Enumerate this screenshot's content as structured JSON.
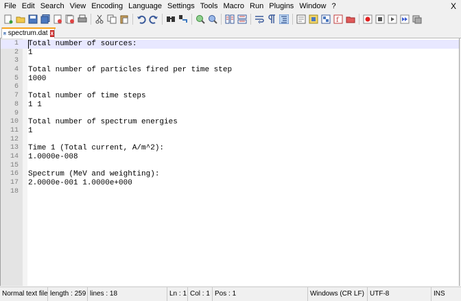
{
  "menu": [
    "File",
    "Edit",
    "Search",
    "View",
    "Encoding",
    "Language",
    "Settings",
    "Tools",
    "Macro",
    "Run",
    "Plugins",
    "Window",
    "?"
  ],
  "window_close": "X",
  "toolbar": [
    "new-file-icon",
    "open-file-icon",
    "save-icon",
    "save-all-icon",
    "close-icon",
    "close-all-icon",
    "print-icon",
    "cut-icon",
    "copy-icon",
    "paste-icon",
    "undo-icon",
    "redo-icon",
    "find-icon",
    "replace-icon",
    "zoom-in-icon",
    "zoom-out-icon",
    "sync-vertical-icon",
    "sync-horizontal-icon",
    "word-wrap-icon",
    "show-all-characters-icon",
    "indent-guide-icon",
    "user-language-icon",
    "document-map-icon",
    "function-list-icon",
    "folder-as-workspace-icon",
    "monitoring-icon",
    "record-macro-icon",
    "stop-recording-icon",
    "playback-macro-icon",
    "run-macro-multiple-icon",
    "save-macro-icon"
  ],
  "tab": {
    "label": "spectrum.dat",
    "close": "x"
  },
  "editor": {
    "lines": [
      "Total number of sources:",
      "1",
      "",
      "Total number of particles fired per time step",
      "1000",
      "",
      "Total number of time steps",
      "1 1",
      "",
      "Total number of spectrum energies",
      "1",
      "",
      "Time 1 (Total current, A/m^2):",
      "1.0000e-008",
      "",
      "Spectrum (MeV and weighting):",
      "2.0000e-001 1.0000e+000",
      ""
    ],
    "current_line": 1
  },
  "status": {
    "file_type": "Normal text file",
    "length": "length : 259",
    "lines": "lines : 18",
    "ln": "Ln : 1",
    "col": "Col : 1",
    "pos": "Pos : 1",
    "eol": "Windows (CR LF)",
    "encoding": "UTF-8",
    "mode": "INS"
  },
  "colors": {
    "tab_accent": "#f7a21b",
    "current_line_bg": "#e8e8ff",
    "gutter_bg": "#e4e4e4"
  }
}
